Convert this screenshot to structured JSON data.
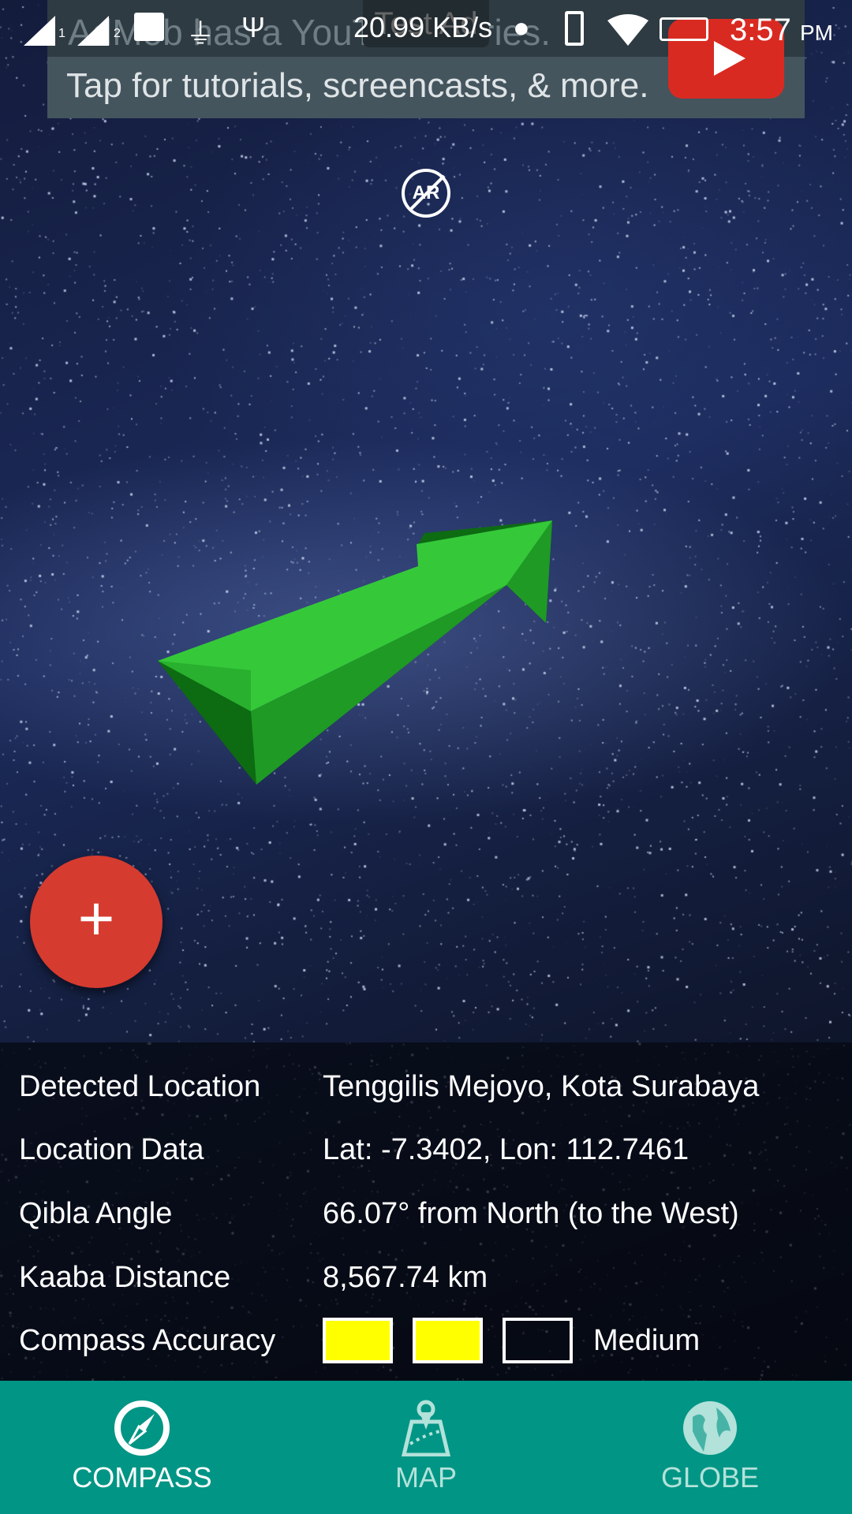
{
  "status_bar": {
    "sim1": "1",
    "sim2": "2",
    "network_speed": "20.99 KB/s",
    "time": "3:57",
    "ampm": "PM",
    "icons": [
      "signal-sim1-icon",
      "signal-sim2-icon",
      "image-icon",
      "charging-plug-icon",
      "usb-icon",
      "location-pin-icon",
      "vibrate-icon",
      "wifi-icon",
      "battery-charging-icon"
    ]
  },
  "ad": {
    "label": "Test Ad",
    "title": "AdMob has a YouTube series.",
    "subtitle": "Tap for tutorials, screencasts, & more.",
    "icon": "youtube-play-icon"
  },
  "ar_toggle": {
    "label": "AR",
    "state": "off"
  },
  "fab": {
    "label": "+"
  },
  "info": {
    "rows": [
      {
        "label": "Detected Location",
        "value": "Tenggilis Mejoyo, Kota Surabaya"
      },
      {
        "label": "Location Data",
        "value": "Lat: -7.3402, Lon: 112.7461"
      },
      {
        "label": "Qibla Angle",
        "value": "66.07° from North (to the West)"
      },
      {
        "label": "Kaaba Distance",
        "value": "8,567.74 km"
      }
    ],
    "accuracy": {
      "label": "Compass Accuracy",
      "level": "Medium",
      "filled": 2,
      "total": 3,
      "fill_color": "#ffff00"
    }
  },
  "nav": {
    "active": "compass",
    "tabs": [
      {
        "id": "compass",
        "label": "COMPASS"
      },
      {
        "id": "map",
        "label": "MAP"
      },
      {
        "id": "globe",
        "label": "GLOBE"
      }
    ],
    "color": "#009585"
  }
}
